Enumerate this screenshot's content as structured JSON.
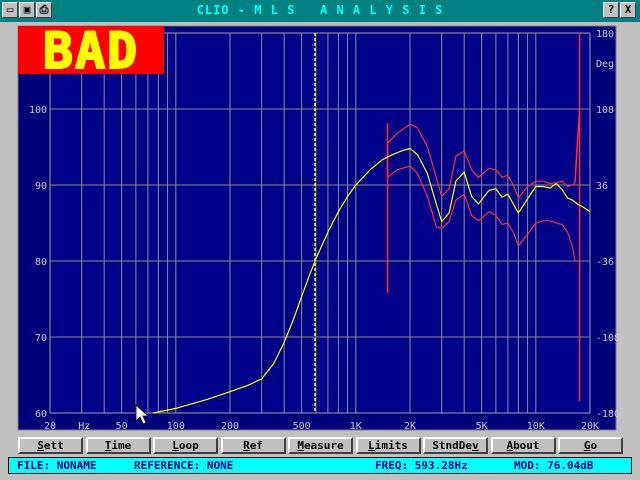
{
  "window": {
    "title": "CLIO - M L S   A N A L Y S I S",
    "left_icons": [
      "folder-icon",
      "disk-icon",
      "printer-icon"
    ],
    "right_buttons": {
      "help": "?",
      "close": "X"
    }
  },
  "badge": {
    "text": "BAD",
    "fg": "#ffff00",
    "bg": "#ff0000"
  },
  "chart_data": {
    "type": "line",
    "x_scale": "log",
    "xlim": [
      20,
      20000
    ],
    "ylim": [
      60,
      110
    ],
    "y2lim": [
      -180,
      180
    ],
    "grid": true,
    "x_tick_labels": [
      "20",
      "Hz",
      "50",
      "100",
      "200",
      "500",
      "1K",
      "2K",
      "5K",
      "10K",
      "20K"
    ],
    "y_tick_labels": [
      "60",
      "70",
      "80",
      "90",
      "100"
    ],
    "y2_tick_labels": [
      "-180",
      "-108",
      "-36",
      "36",
      "108",
      "180"
    ],
    "y2_unit": "Deg",
    "cursor_freq": 593.28,
    "limit_band": [
      1500,
      17500
    ],
    "series": [
      {
        "color": "#ffff00",
        "x": [
          75,
          100,
          150,
          200,
          250,
          300,
          350,
          400,
          450,
          500,
          550,
          600,
          700,
          800,
          900,
          1000,
          1200,
          1400,
          1600,
          1800,
          2000,
          2200,
          2500,
          2800,
          3000,
          3300,
          3600,
          4000,
          4400,
          4800,
          5500,
          6000,
          6500,
          7000,
          7500,
          8000,
          9000,
          10000,
          11000,
          12000,
          13000,
          14000,
          15000,
          16000,
          17000,
          18000,
          20000
        ],
        "y": [
          60,
          60.6,
          61.8,
          62.8,
          63.6,
          64.5,
          66.5,
          69.3,
          72.3,
          75.3,
          78.0,
          80.3,
          83.8,
          86.5,
          88.5,
          90.0,
          92.0,
          93.3,
          94.0,
          94.5,
          94.8,
          94.0,
          91.5,
          87.5,
          85.2,
          86.3,
          90.5,
          91.7,
          88.5,
          87.5,
          89.3,
          89.5,
          88.4,
          88.8,
          87.5,
          86.3,
          88.2,
          89.8,
          89.8,
          89.6,
          90.2,
          89.4,
          88.3,
          88.0,
          87.5,
          87.2,
          86.5
        ]
      },
      {
        "color": "#ff3030",
        "x": [
          1500,
          1700,
          2000,
          2200,
          2500,
          2800,
          3000,
          3300,
          3600,
          4000,
          4400,
          4800,
          5500,
          6000,
          6500,
          7000,
          7500,
          8000,
          9000,
          10000,
          11000,
          12000,
          13000,
          14000,
          15000,
          16000,
          16500
        ],
        "y": [
          95.5,
          96.8,
          98.0,
          97.5,
          95.0,
          91.0,
          88.5,
          89.5,
          93.8,
          94.5,
          92.0,
          91.0,
          92.2,
          92.0,
          91.0,
          91.3,
          90.0,
          88.3,
          89.8,
          90.5,
          90.5,
          90.2,
          90.3,
          90.5,
          89.8,
          90.0,
          90.3
        ]
      },
      {
        "color": "#ff3030",
        "x": [
          1500,
          1700,
          2000,
          2200,
          2500,
          2800,
          3000,
          3300,
          3600,
          4000,
          4400,
          4800,
          5500,
          6000,
          6500,
          7000,
          7500,
          8000,
          9000,
          10000,
          11000,
          12000,
          13000,
          14000,
          15000,
          16000,
          16500
        ],
        "y": [
          91.0,
          92.0,
          92.5,
          91.5,
          88.5,
          84.5,
          84.3,
          85.2,
          88.0,
          88.8,
          86.0,
          85.3,
          86.5,
          86.0,
          84.8,
          85.0,
          83.8,
          82.0,
          83.5,
          85.0,
          85.3,
          85.3,
          85.0,
          84.8,
          83.8,
          81.8,
          80.0
        ]
      }
    ]
  },
  "buttons": [
    {
      "prefix": "S",
      "rest": "ett"
    },
    {
      "prefix": "T",
      "rest": "ime"
    },
    {
      "prefix": "L",
      "rest": "oop"
    },
    {
      "prefix": "R",
      "rest": "ef"
    },
    {
      "prefix": "M",
      "rest": "easure"
    },
    {
      "prefix": "L",
      "rest": "imits"
    },
    {
      "prefix": "StndDe",
      "rest": "v"
    },
    {
      "prefix": "A",
      "rest": "bout"
    },
    {
      "prefix": "G",
      "rest": "o"
    }
  ],
  "status": {
    "file": "FILE: NONAME",
    "reference": "REFERENCE: NONE",
    "freq": "FREQ: 593.28Hz",
    "mod": "MOD: 76.04dB"
  }
}
